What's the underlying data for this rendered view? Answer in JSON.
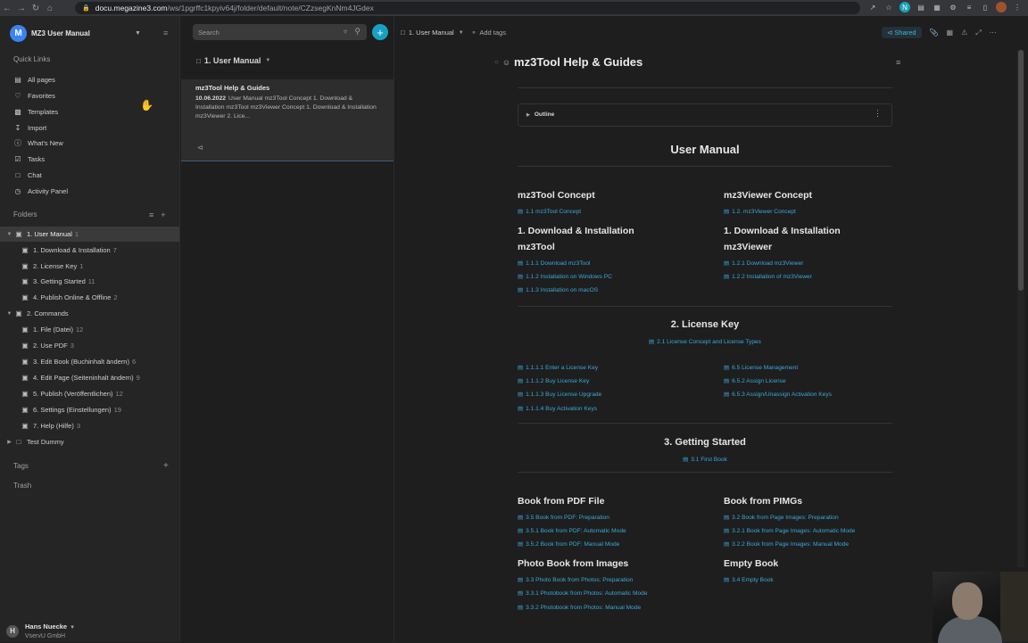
{
  "browser": {
    "url_host": "docu.megazine3.com",
    "url_path": "/ws/1pgrffc1kpyiv64j/folder/default/note/CZzsegKnNm4JGdex"
  },
  "sidebar": {
    "workspace_initial": "M",
    "workspace_name": "MZ3 User Manual",
    "quick_links_title": "Quick Links",
    "quick_links": [
      {
        "label": "All pages",
        "icon": "file-icon"
      },
      {
        "label": "Favorites",
        "icon": "heart-icon"
      },
      {
        "label": "Templates",
        "icon": "templates-icon"
      },
      {
        "label": "Import",
        "icon": "import-icon"
      },
      {
        "label": "What's New",
        "icon": "info-icon"
      },
      {
        "label": "Tasks",
        "icon": "tasks-icon"
      },
      {
        "label": "Chat",
        "icon": "chat-icon"
      },
      {
        "label": "Activity Panel",
        "icon": "clock-icon"
      }
    ],
    "folders_title": "Folders",
    "folders": [
      {
        "label": "1. User Manual",
        "count": "1"
      },
      {
        "label": "1. Download & Installation",
        "count": "7"
      },
      {
        "label": "2. License Key",
        "count": "1"
      },
      {
        "label": "3. Getting Started",
        "count": "11"
      },
      {
        "label": "4. Publish Online & Offline",
        "count": "2"
      },
      {
        "label": "2. Commands",
        "count": ""
      },
      {
        "label": "1. File (Datei)",
        "count": "12"
      },
      {
        "label": "2. Use PDF",
        "count": "3"
      },
      {
        "label": "3. Edit Book (Buchinhalt ändern)",
        "count": "6"
      },
      {
        "label": "4. Edit Page (Seiteninhalt ändern)",
        "count": "9"
      },
      {
        "label": "5. Publish (Veröffentlichen)",
        "count": "12"
      },
      {
        "label": "6. Settings (Einstellungen)",
        "count": "19"
      },
      {
        "label": "7. Help (Hilfe)",
        "count": "3"
      },
      {
        "label": "Test Dummy",
        "count": ""
      }
    ],
    "tags_title": "Tags",
    "trash_label": "Trash",
    "user": {
      "initial": "H",
      "name": "Hans Nuecke",
      "org": "VservU GmbH"
    }
  },
  "notelist": {
    "search_placeholder": "Search",
    "folder_label": "1. User Manual",
    "note": {
      "title": "mz3Tool Help & Guides",
      "date": "10.06.2022",
      "snippet": "User Manual mz3Tool Concept 1. Download & Installation mz3Tool mz3Viewer Concept 1. Download & Installation mz3Viewer 2. Lice..."
    }
  },
  "editor": {
    "breadcrumb_folder": "1. User Manual",
    "add_tags_label": "Add tags",
    "shared_label": "Shared",
    "title": "mz3Tool Help & Guides",
    "outline_label": "Outline",
    "user_manual_heading": "User Manual",
    "left_concept_heading": "mz3Tool Concept",
    "left_concept_links": [
      "1.1 mz3Tool Concept"
    ],
    "right_concept_heading": "mz3Viewer Concept",
    "right_concept_links": [
      "1.2. mz3Viewer Concept"
    ],
    "left_download_heading_1": "1. Download & Installation",
    "left_download_heading_2": "mz3Tool",
    "left_download_links": [
      "1.1.1 Download mz3Tool",
      "1.1.2 Installation on Windows PC",
      "1.1.3 Installation on macOS"
    ],
    "right_download_heading_1": "1. Download & Installation",
    "right_download_heading_2": "mz3Viewer",
    "right_download_links": [
      "1.2.1 Download mz3Viewer",
      "1.2.2 Installation of mz3Viewer"
    ],
    "license_heading": "2. License Key",
    "license_center_link": "2.1 License Concept and License Types",
    "license_left_links": [
      "1.1.1.1 Enter a License Key",
      "1.1.1.2  Buy License Key",
      "1.1.1.3 Buy License Upgrade",
      "1.1.1.4 Buy Activation Keys"
    ],
    "license_right_links": [
      "6.5 License Management",
      "6.5.2 Assign License",
      "6.5.3 Assign/Unassign Activation Keys"
    ],
    "getting_started_heading": "3. Getting Started",
    "getting_started_link": "3.1 First Book",
    "pdf_heading": "Book from PDF File",
    "pdf_links": [
      "3.5  Book from PDF: Preparation",
      "3.5.1 Book from PDF: Automatic Mode",
      "3.5.2 Book from PDF: Manual Mode"
    ],
    "pimg_heading": "Book from PIMGs",
    "pimg_links": [
      "3.2 Book from Page Images: Preparation",
      "3.2.1 Book from Page Images: Automatic Mode",
      "3.2.2 Book from Page Images: Manual Mode"
    ],
    "photo_heading": "Photo Book from Images",
    "photo_links": [
      "3.3 Photo Book from Photos: Preparation",
      "3.3.1 Photobook from Photos: Automatic Mode",
      "3.3.2 Photobook from Photos: Manual Mode"
    ],
    "empty_heading": "Empty Book",
    "empty_links": [
      "3.4 Empty Book"
    ]
  },
  "colors": {
    "accent": "#16a0c4",
    "link": "#3ba8d8",
    "workspace_avatar": "#3b82f6"
  }
}
